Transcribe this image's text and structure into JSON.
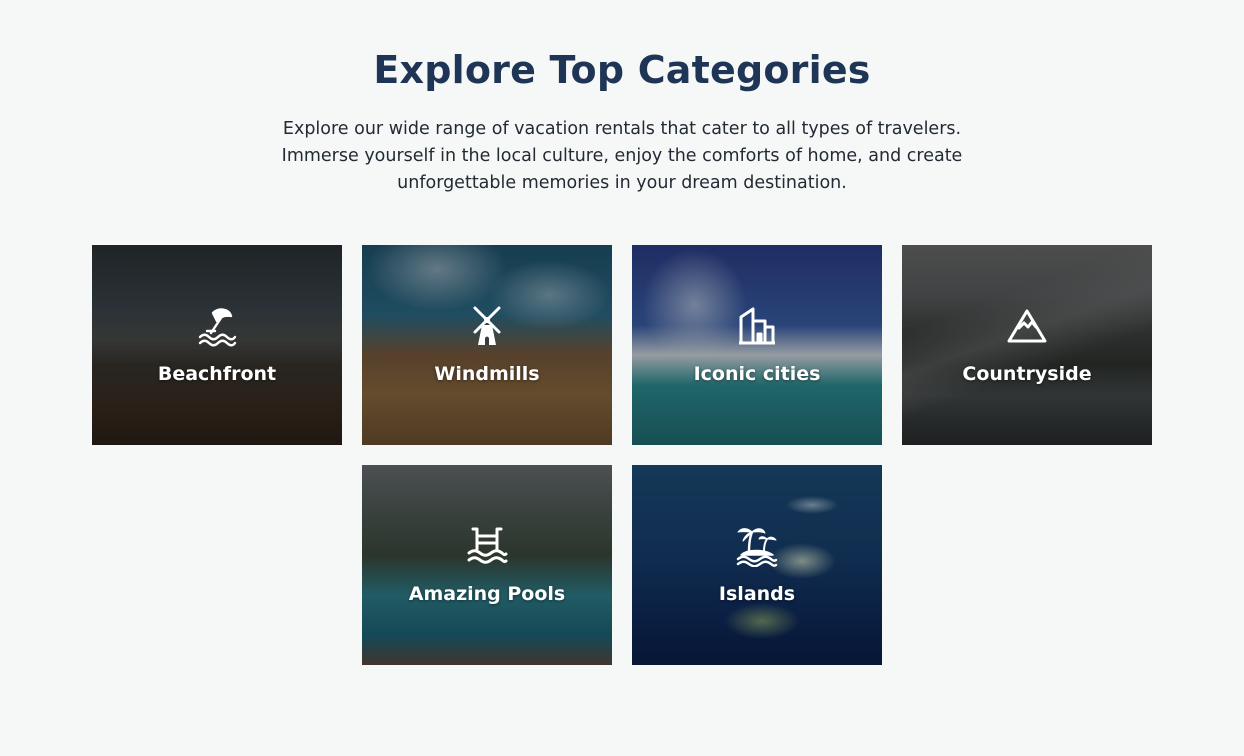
{
  "section": {
    "title": "Explore Top Categories",
    "description": "Explore our wide range of vacation rentals that cater to all types of travelers. Immerse yourself in the local culture, enjoy the comforts of home, and create unforgettable memories in your dream destination."
  },
  "categories": [
    {
      "label": "Beachfront",
      "icon": "beach-umbrella-icon"
    },
    {
      "label": "Windmills",
      "icon": "windmill-icon"
    },
    {
      "label": "Iconic cities",
      "icon": "city-building-icon"
    },
    {
      "label": "Countryside",
      "icon": "mountain-icon"
    },
    {
      "label": "Amazing Pools",
      "icon": "pool-ladder-icon"
    },
    {
      "label": "Islands",
      "icon": "island-palm-icon"
    }
  ],
  "colors": {
    "title": "#1f3556",
    "text": "#222a33",
    "background": "#f6f8f8",
    "card_label": "#ffffff"
  }
}
